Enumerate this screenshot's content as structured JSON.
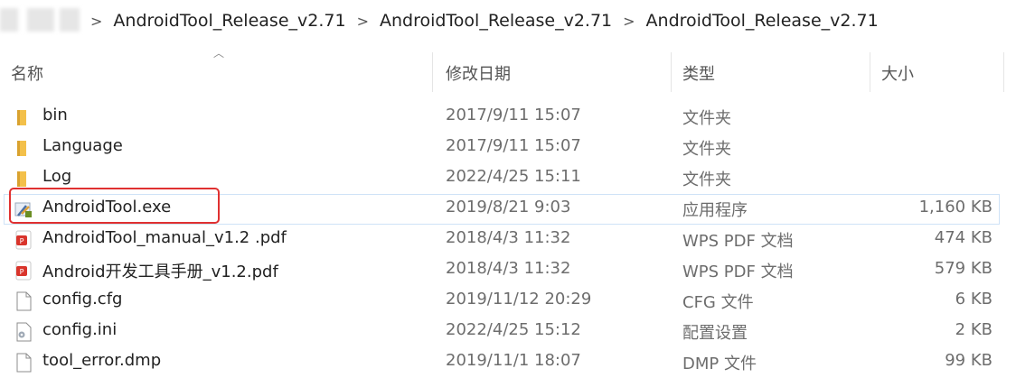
{
  "breadcrumb": {
    "items": [
      "AndroidTool_Release_v2.71",
      "AndroidTool_Release_v2.71",
      "AndroidTool_Release_v2.71"
    ]
  },
  "columns": {
    "name": "名称",
    "date": "修改日期",
    "type": "类型",
    "size": "大小"
  },
  "files": [
    {
      "name": "bin",
      "date": "2017/9/11 15:07",
      "type": "文件夹",
      "size": "",
      "icon": "folder-icon"
    },
    {
      "name": "Language",
      "date": "2017/9/11 15:07",
      "type": "文件夹",
      "size": "",
      "icon": "folder-icon"
    },
    {
      "name": "Log",
      "date": "2022/4/25 15:11",
      "type": "文件夹",
      "size": "",
      "icon": "folder-icon"
    },
    {
      "name": "AndroidTool.exe",
      "date": "2019/8/21 9:03",
      "type": "应用程序",
      "size": "1,160 KB",
      "icon": "exe-icon",
      "selected": true
    },
    {
      "name": "AndroidTool_manual_v1.2 .pdf",
      "date": "2018/4/3 11:32",
      "type": "WPS PDF 文档",
      "size": "474 KB",
      "icon": "pdf-icon"
    },
    {
      "name": "Android开发工具手册_v1.2.pdf",
      "date": "2018/4/3 11:32",
      "type": "WPS PDF 文档",
      "size": "579 KB",
      "icon": "pdf-icon"
    },
    {
      "name": "config.cfg",
      "date": "2019/11/12 20:29",
      "type": "CFG 文件",
      "size": "6 KB",
      "icon": "file-icon"
    },
    {
      "name": "config.ini",
      "date": "2022/4/25 15:12",
      "type": "配置设置",
      "size": "2 KB",
      "icon": "settings-file-icon"
    },
    {
      "name": "tool_error.dmp",
      "date": "2019/11/1 18:07",
      "type": "DMP 文件",
      "size": "99 KB",
      "icon": "file-icon"
    }
  ],
  "colors": {
    "highlight": "#e03131",
    "folder": "#f3c04a",
    "pdf": "#d9342b"
  }
}
